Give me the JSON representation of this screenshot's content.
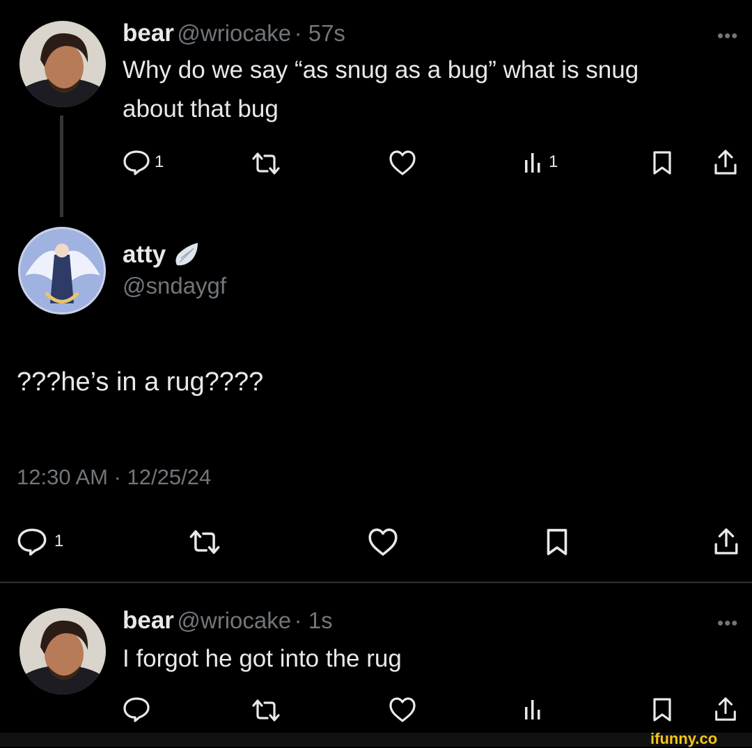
{
  "tweet1": {
    "name": "bear",
    "handle": "@wriocake",
    "time": "· 57s",
    "more": "•••",
    "text_line1": "Why do we say “as snug as a bug” what is snug",
    "text_line2": "about that bug",
    "reply_count": "1",
    "views_count": "1"
  },
  "tweet2": {
    "name": "atty",
    "handle": "@sndaygf",
    "text": "???he’s in a rug????",
    "timestamp": "12:30 AM · 12/25/24",
    "reply_count": "1"
  },
  "tweet3": {
    "name": "bear",
    "handle": "@wriocake",
    "time": "· 1s",
    "more": "•••",
    "text": "I forgot he got into the rug"
  },
  "watermark": "ifunny.co",
  "colors": {
    "background": "#000000",
    "text": "#e7e9ea",
    "secondary": "#71767b",
    "divider": "#2f3336",
    "watermark": "#f5c518"
  },
  "icons": [
    "reply-icon",
    "retweet-icon",
    "like-icon",
    "views-icon",
    "bookmark-icon",
    "share-icon",
    "angel-wing-icon"
  ]
}
